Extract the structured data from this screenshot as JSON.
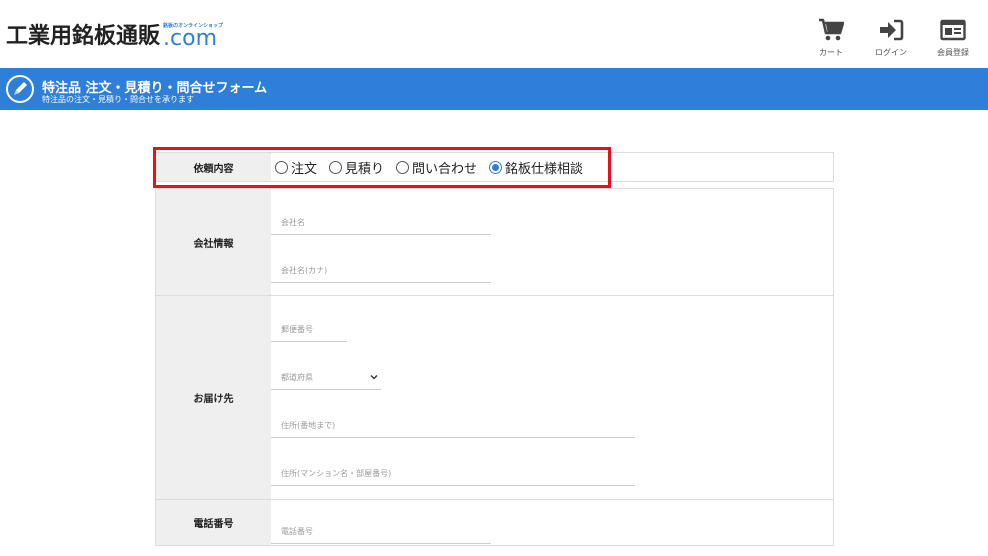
{
  "header": {
    "logo_main": "工業用銘板通販",
    "logo_tagline": "銘板のオンラインショップ",
    "logo_com": ".com",
    "buttons": [
      {
        "label": "カート",
        "icon": "cart-icon"
      },
      {
        "label": "ログイン",
        "icon": "login-icon"
      },
      {
        "label": "会員登録",
        "icon": "member-card-icon"
      }
    ]
  },
  "banner": {
    "title": "特注品 注文・見積り・問合せフォーム",
    "subtitle": "特注品の注文・見積り・問合せを承ります",
    "icon": "pen-icon"
  },
  "form": {
    "request_type": {
      "label": "依頼内容",
      "options": [
        "注文",
        "見積り",
        "問い合わせ",
        "銘板仕様相談"
      ],
      "selected": "銘板仕様相談"
    },
    "company": {
      "label": "会社情報",
      "name_placeholder": "会社名",
      "kana_placeholder": "会社名(カナ)"
    },
    "delivery": {
      "label": "お届け先",
      "zip_placeholder": "郵便番号",
      "prefecture_placeholder": "都道府県",
      "address1_placeholder": "住所(番地まで)",
      "address2_placeholder": "住所(マンション名・部屋番号)"
    },
    "phone": {
      "label": "電話番号",
      "placeholder": "電話番号"
    }
  },
  "colors": {
    "accent": "#2f7fd8",
    "highlight": "#e0141e"
  }
}
